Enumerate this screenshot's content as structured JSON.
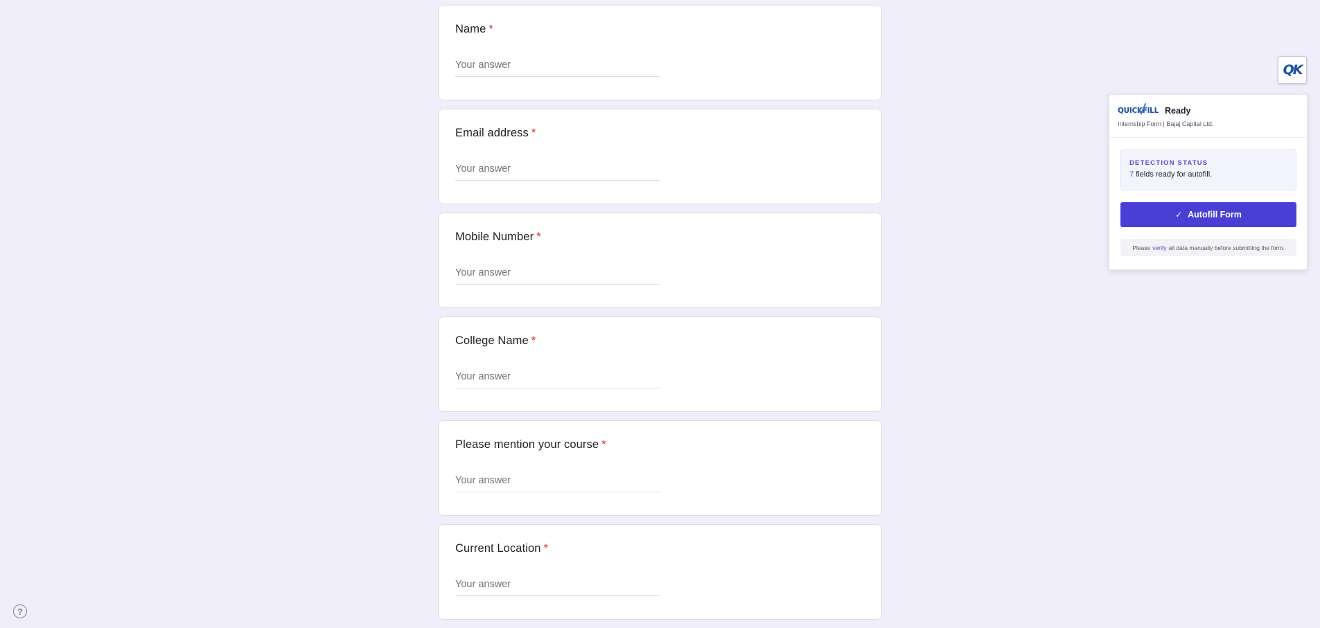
{
  "form": {
    "questions": [
      {
        "title": "Name",
        "required_mark": "*",
        "placeholder": "Your answer"
      },
      {
        "title": "Email address",
        "required_mark": "*",
        "placeholder": "Your answer"
      },
      {
        "title": "Mobile Number",
        "required_mark": "*",
        "placeholder": "Your answer"
      },
      {
        "title": "College Name",
        "required_mark": "*",
        "placeholder": "Your answer"
      },
      {
        "title": "Please mention your course",
        "required_mark": "*",
        "placeholder": "Your answer"
      },
      {
        "title": "Current Location",
        "required_mark": "*",
        "placeholder": "Your answer"
      }
    ]
  },
  "help": {
    "icon": "help-circle-icon",
    "glyph": "?"
  },
  "extension": {
    "toggle_label": "QK",
    "brand": "QUICKFILL",
    "status": "Ready",
    "form_name": "Internship Form | Bajaj Capital Ltd.",
    "detection_label": "DETECTION STATUS",
    "field_count": "7",
    "field_text": "fields ready for autofill.",
    "autofill_label": "Autofill Form",
    "note_before": "Please",
    "note_link": "verify",
    "note_after": "all data manually before submitting the form."
  },
  "colors": {
    "background": "#efeefa",
    "required": "#d93025",
    "accent": "#4a3fd4",
    "brand": "#1a4fa0"
  }
}
